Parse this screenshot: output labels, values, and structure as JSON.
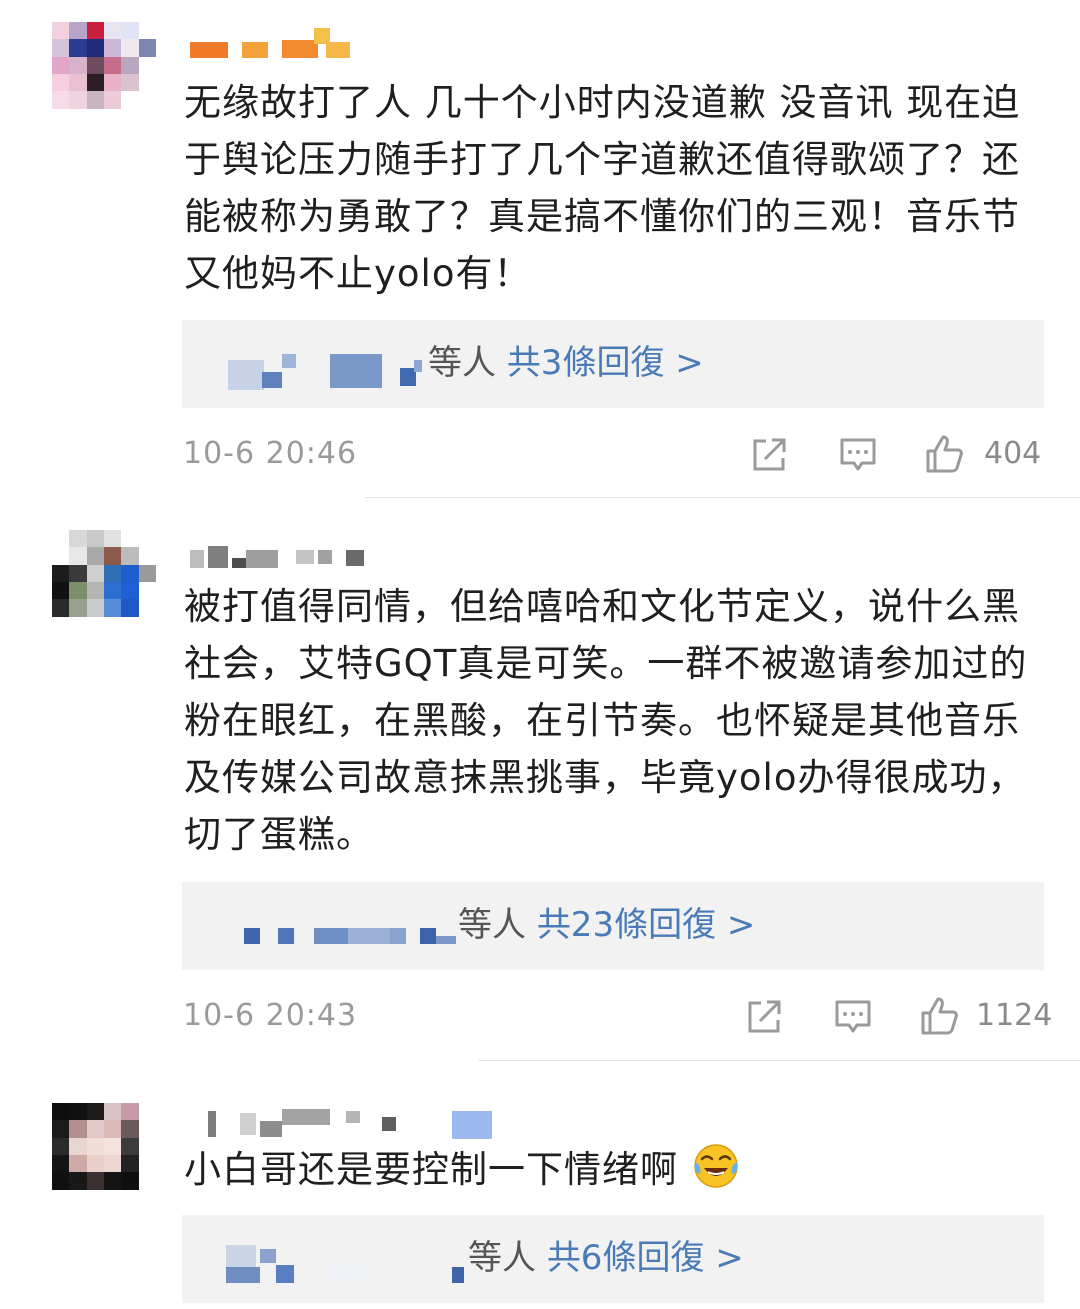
{
  "comments": [
    {
      "text": "无缘故打了人 几十个小时内没道歉 没音讯 现在迫于舆论压力随手打了几个字道歉还值得歌颂了？还能被称为勇敢了？真是搞不懂你们的三观！音乐节又他妈不止yolo有！",
      "reply_who": "等人",
      "reply_count": "共3條回復 >",
      "time": "10-6 20:46",
      "likes": "404"
    },
    {
      "text": "被打值得同情，但给嘻哈和文化节定义，说什么黑社会，艾特GQT真是可笑。一群不被邀请参加过的粉在眼红，在黑酸，在引节奏。也怀疑是其他音乐及传媒公司故意抹黑挑事，毕竟yolo办得很成功，切了蛋糕。",
      "reply_who": "等人",
      "reply_count": "共23條回復 >",
      "time": "10-6 20:43",
      "likes": "1124"
    },
    {
      "text": "小白哥还是要控制一下情绪啊",
      "reply_who": "等人",
      "reply_count": "共6條回復 >",
      "emoji": "crying-laughing-emoji"
    }
  ],
  "icons": {
    "share": "share-icon",
    "comment": "comment-icon",
    "like": "thumbs-up-icon"
  },
  "colors": {
    "link": "#4a7bb7",
    "meta": "#9a9a9a",
    "reply_bg": "#f2f2f2"
  }
}
